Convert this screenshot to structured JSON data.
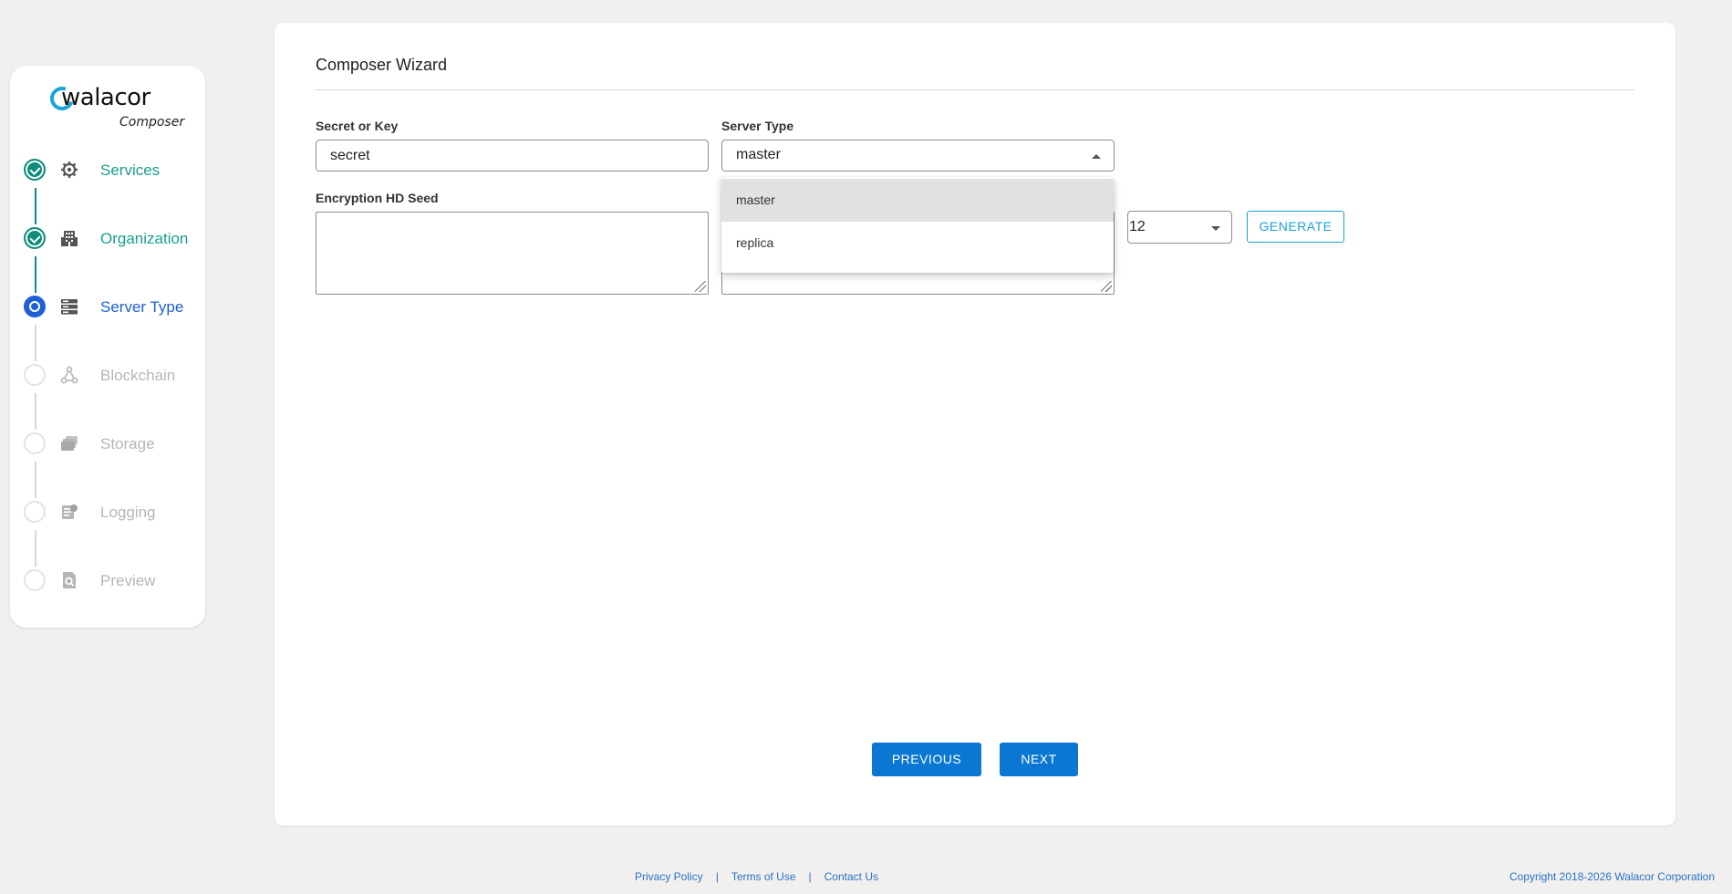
{
  "brand": {
    "name": "walacor",
    "product": "Composer"
  },
  "steps": [
    {
      "label": "Services",
      "state": "done",
      "icon": "gear-icon"
    },
    {
      "label": "Organization",
      "state": "done",
      "icon": "building-icon"
    },
    {
      "label": "Server Type",
      "state": "active",
      "icon": "server-icon"
    },
    {
      "label": "Blockchain",
      "state": "pending",
      "icon": "network-icon"
    },
    {
      "label": "Storage",
      "state": "pending",
      "icon": "folder-stack-icon"
    },
    {
      "label": "Logging",
      "state": "pending",
      "icon": "log-icon"
    },
    {
      "label": "Preview",
      "state": "pending",
      "icon": "document-search-icon"
    }
  ],
  "wizard": {
    "title": "Composer Wizard",
    "secret": {
      "label": "Secret or Key",
      "value": "secret"
    },
    "server_type": {
      "label": "Server Type",
      "value": "master",
      "options": [
        "master",
        "replica"
      ]
    },
    "seed": {
      "label": "Encryption HD Seed",
      "value": ""
    },
    "word_count": {
      "value": "12"
    },
    "generate_label": "GENERATE",
    "previous_label": "PREVIOUS",
    "next_label": "NEXT"
  },
  "footer": {
    "links": [
      "Privacy Policy",
      "Terms of Use",
      "Contact Us"
    ],
    "separator": "|",
    "copyright": "Copyright 2018-2026 Walacor Corporation"
  },
  "colors": {
    "done": "#0f8c7a",
    "active": "#1f5fd6",
    "pending": "#b6b6b6",
    "primary_button": "#0a78d2",
    "outline_button": "#1aa0d8"
  }
}
